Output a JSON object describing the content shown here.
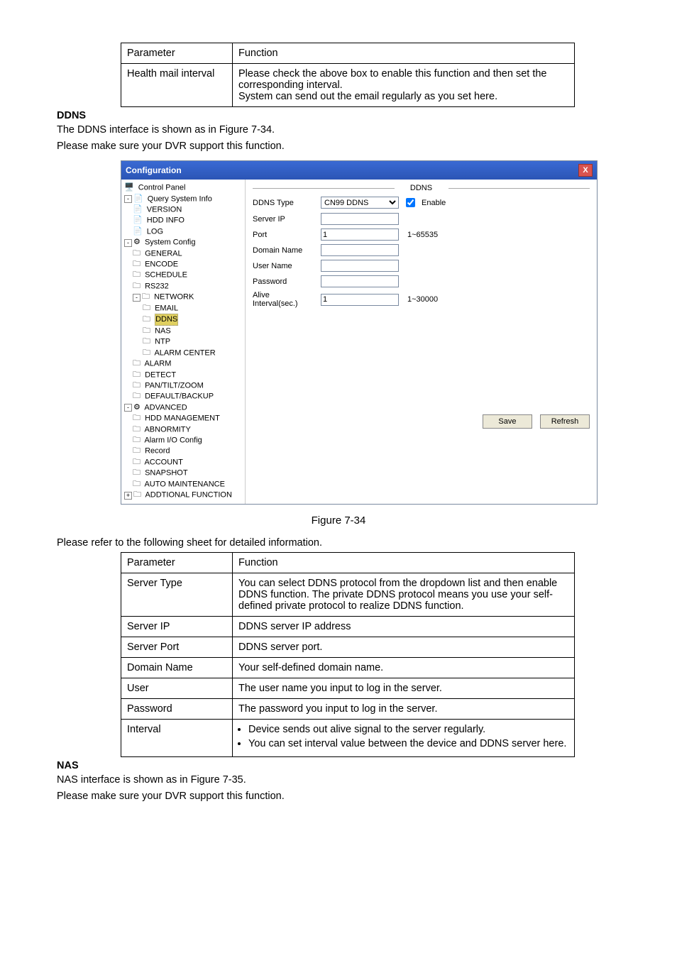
{
  "table1": {
    "headers": [
      "Parameter",
      "Function"
    ],
    "rows": [
      {
        "param": "Health mail interval",
        "func": "Please check the above box to enable this function and then set the corresponding interval.\nSystem can send out the email regularly as you set here."
      }
    ]
  },
  "ddns": {
    "heading": "DDNS",
    "intro1": "The DDNS interface is shown as in Figure 7-34.",
    "intro2": "Please make sure your DVR support this function."
  },
  "config_window": {
    "title": "Configuration",
    "close": "X",
    "tree": [
      {
        "label": "Control Panel",
        "level": 0,
        "icon": "cp-icon"
      },
      {
        "label": "Query System Info",
        "level": 0,
        "icon": "file-icon",
        "expander": "-"
      },
      {
        "label": "VERSION",
        "level": 1,
        "icon": "file-icon"
      },
      {
        "label": "HDD INFO",
        "level": 1,
        "icon": "file-icon"
      },
      {
        "label": "LOG",
        "level": 1,
        "icon": "file-icon"
      },
      {
        "label": "System Config",
        "level": 0,
        "icon": "tool-icon",
        "expander": "-"
      },
      {
        "label": "GENERAL",
        "level": 1,
        "icon": "folder-icon"
      },
      {
        "label": "ENCODE",
        "level": 1,
        "icon": "folder-icon"
      },
      {
        "label": "SCHEDULE",
        "level": 1,
        "icon": "folder-icon"
      },
      {
        "label": "RS232",
        "level": 1,
        "icon": "folder-icon"
      },
      {
        "label": "NETWORK",
        "level": 1,
        "icon": "folder-icon",
        "expander": "-"
      },
      {
        "label": "EMAIL",
        "level": 2,
        "icon": "folder-icon"
      },
      {
        "label": "DDNS",
        "level": 2,
        "icon": "folder-icon",
        "selected": true
      },
      {
        "label": "NAS",
        "level": 2,
        "icon": "folder-icon"
      },
      {
        "label": "NTP",
        "level": 2,
        "icon": "folder-icon"
      },
      {
        "label": "ALARM CENTER",
        "level": 2,
        "icon": "folder-icon"
      },
      {
        "label": "ALARM",
        "level": 1,
        "icon": "folder-icon"
      },
      {
        "label": "DETECT",
        "level": 1,
        "icon": "folder-icon"
      },
      {
        "label": "PAN/TILT/ZOOM",
        "level": 1,
        "icon": "folder-icon"
      },
      {
        "label": "DEFAULT/BACKUP",
        "level": 1,
        "icon": "folder-icon"
      },
      {
        "label": "ADVANCED",
        "level": 0,
        "icon": "tool-icon",
        "expander": "-"
      },
      {
        "label": "HDD MANAGEMENT",
        "level": 1,
        "icon": "folder-icon"
      },
      {
        "label": "ABNORMITY",
        "level": 1,
        "icon": "folder-icon"
      },
      {
        "label": "Alarm I/O Config",
        "level": 1,
        "icon": "folder-icon"
      },
      {
        "label": "Record",
        "level": 1,
        "icon": "folder-icon"
      },
      {
        "label": "ACCOUNT",
        "level": 1,
        "icon": "folder-icon"
      },
      {
        "label": "SNAPSHOT",
        "level": 1,
        "icon": "folder-icon"
      },
      {
        "label": "AUTO MAINTENANCE",
        "level": 1,
        "icon": "folder-icon"
      },
      {
        "label": "ADDTIONAL FUNCTION",
        "level": 0,
        "icon": "folder-icon",
        "expander": "+"
      }
    ],
    "panel_title": "DDNS",
    "fields": {
      "ddns_type_label": "DDNS Type",
      "ddns_type_value": "CN99 DDNS",
      "enable_label": "Enable",
      "enable_checked": true,
      "server_ip_label": "Server IP",
      "server_ip_value": "",
      "port_label": "Port",
      "port_value": "1",
      "port_hint": "1~65535",
      "domain_label": "Domain Name",
      "domain_value": "",
      "user_label": "User Name",
      "user_value": "",
      "pass_label": "Password",
      "pass_value": "",
      "alive_label": "Alive Interval(sec.)",
      "alive_value": "1",
      "alive_hint": "1~30000"
    },
    "buttons": {
      "save": "Save",
      "refresh": "Refresh"
    }
  },
  "figure_caption": "Figure 7-34",
  "please_refer": "Please refer to the following sheet for detailed information.",
  "table2": {
    "headers": [
      "Parameter",
      "Function"
    ],
    "rows": [
      {
        "param": "Server Type",
        "func": "You can select DDNS protocol from the dropdown list and then enable DDNS function. The private DDNS protocol means you use your self-defined private protocol to realize DDNS function."
      },
      {
        "param": "Server IP",
        "func": "DDNS server IP address"
      },
      {
        "param": "Server Port",
        "func": "DDNS server port."
      },
      {
        "param": "Domain Name",
        "func": "Your self-defined domain name."
      },
      {
        "param": "User",
        "func": "The user name you input to log in the server."
      },
      {
        "param": "Password",
        "func": "The password you input to log in the server."
      },
      {
        "param": "Interval",
        "func_bullets": [
          "Device sends out alive signal to the server regularly.",
          "You can set interval value between the device and DDNS server here."
        ]
      }
    ]
  },
  "nas": {
    "heading": "NAS",
    "intro1": "NAS interface is shown as in Figure 7-35.",
    "intro2": "Please make sure your DVR support this function."
  }
}
